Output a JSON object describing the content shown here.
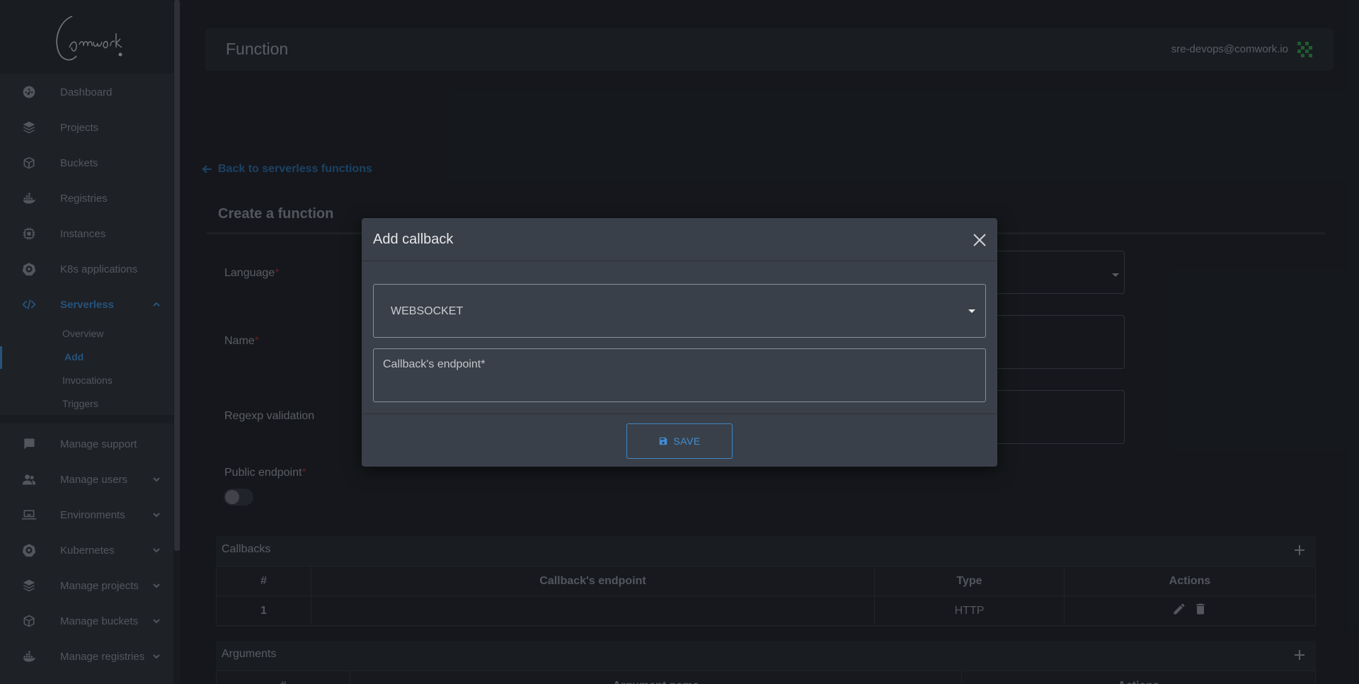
{
  "brand": {
    "logo_text": "Comwork"
  },
  "sidebar": {
    "items": [
      {
        "label": "Dashboard",
        "icon": "dashboard-icon"
      },
      {
        "label": "Projects",
        "icon": "layers-icon"
      },
      {
        "label": "Buckets",
        "icon": "box-icon"
      },
      {
        "label": "Registries",
        "icon": "docker-icon"
      },
      {
        "label": "Instances",
        "icon": "chip-icon"
      },
      {
        "label": "K8s applications",
        "icon": "helm-icon"
      },
      {
        "label": "Serverless",
        "icon": "code-icon",
        "expanded": true
      },
      {
        "label": "Manage support",
        "icon": "chat-icon"
      },
      {
        "label": "Manage users",
        "icon": "users-icon"
      },
      {
        "label": "Environments",
        "icon": "laptop-icon"
      },
      {
        "label": "Kubernetes",
        "icon": "helm-icon"
      },
      {
        "label": "Manage projects",
        "icon": "layers-icon"
      },
      {
        "label": "Manage buckets",
        "icon": "box-icon"
      },
      {
        "label": "Manage registries",
        "icon": "docker-icon"
      }
    ],
    "serverless_sub": [
      {
        "label": "Overview"
      },
      {
        "label": "Add",
        "active": true
      },
      {
        "label": "Invocations"
      },
      {
        "label": "Triggers"
      }
    ]
  },
  "header": {
    "title": "Function",
    "user_email": "sre-devops@comwork.io"
  },
  "page": {
    "back_link": "Back to serverless functions",
    "section_title": "Create a function",
    "fields": {
      "language_label": "Language",
      "name_label": "Name",
      "regexp_label": "Regexp validation",
      "public_endpoint_label": "Public endpoint",
      "required_mark": "*"
    },
    "callbacks": {
      "title": "Callbacks",
      "columns": [
        "#",
        "Callback's endpoint",
        "Type",
        "Actions"
      ],
      "rows": [
        {
          "num": "1",
          "endpoint": "",
          "type": "HTTP"
        }
      ]
    },
    "arguments": {
      "title": "Arguments",
      "columns": [
        "#",
        "Argument name",
        "Actions"
      ]
    }
  },
  "modal": {
    "title": "Add callback",
    "type_select_value": "WEBSOCKET",
    "endpoint_placeholder": "Callback's endpoint*",
    "endpoint_value": "",
    "save_label": "SAVE"
  },
  "colors": {
    "accent": "#3b8fd4",
    "required": "#a63232",
    "modal_bg": "#3a4049"
  }
}
